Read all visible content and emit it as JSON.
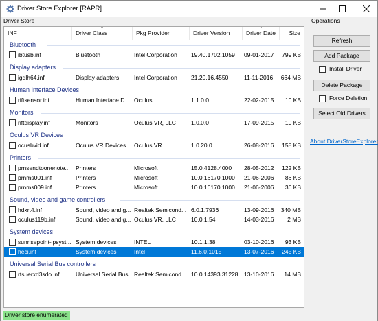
{
  "window": {
    "title": "Driver Store Explorer [RAPR]"
  },
  "labels": {
    "driver_store": "Driver Store",
    "operations": "Operations"
  },
  "columns": {
    "inf": "INF",
    "driver_class": "Driver Class",
    "pkg_provider": "Pkg Provider",
    "driver_version": "Driver Version",
    "driver_date": "Driver Date",
    "size": "Size"
  },
  "groups": {
    "bluetooth": "Bluetooth",
    "display_adapters": "Display adapters",
    "human_interface_devices": "Human Interface Devices",
    "monitors": "Monitors",
    "oculus_vr_devices": "Oculus VR Devices",
    "printers": "Printers",
    "sound_video_game": "Sound, video and game controllers",
    "system_devices": "System devices",
    "usb_controllers": "Universal Serial Bus controllers"
  },
  "rows": [
    {
      "inf": "ibtusb.inf",
      "class": "Bluetooth",
      "provider": "Intel Corporation",
      "version": "19.40.1702.1059",
      "date": "09-01-2017",
      "size": "799 KB"
    },
    {
      "inf": "igdlh64.inf",
      "class": "Display adapters",
      "provider": "Intel Corporation",
      "version": "21.20.16.4550",
      "date": "11-11-2016",
      "size": "664 MB"
    },
    {
      "inf": "riftsensor.inf",
      "class": "Human Interface D...",
      "provider": "Oculus",
      "version": "1.1.0.0",
      "date": "22-02-2015",
      "size": "10 KB"
    },
    {
      "inf": "riftdisplay.inf",
      "class": "Monitors",
      "provider": "Oculus VR, LLC",
      "version": "1.0.0.0",
      "date": "17-09-2015",
      "size": "10 KB"
    },
    {
      "inf": "ocusbvid.inf",
      "class": "Oculus VR Devices",
      "provider": "Oculus VR",
      "version": "1.0.20.0",
      "date": "26-08-2016",
      "size": "158 KB"
    },
    {
      "inf": "prnsendtoonenote...",
      "class": "Printers",
      "provider": "Microsoft",
      "version": "15.0.4128.4000",
      "date": "28-05-2012",
      "size": "122 KB"
    },
    {
      "inf": "prnms001.inf",
      "class": "Printers",
      "provider": "Microsoft",
      "version": "10.0.16170.1000",
      "date": "21-06-2006",
      "size": "86 KB"
    },
    {
      "inf": "prnms009.inf",
      "class": "Printers",
      "provider": "Microsoft",
      "version": "10.0.16170.1000",
      "date": "21-06-2006",
      "size": "36 KB"
    },
    {
      "inf": "hdxrt4.inf",
      "class": "Sound, video and g...",
      "provider": "Realtek Semicond...",
      "version": "6.0.1.7936",
      "date": "13-09-2016",
      "size": "340 MB"
    },
    {
      "inf": "oculus119b.inf",
      "class": "Sound, video and g...",
      "provider": "Oculus VR, LLC",
      "version": "10.0.1.54",
      "date": "14-03-2016",
      "size": "2 MB"
    },
    {
      "inf": "sunrisepoint-lpsyst...",
      "class": "System devices",
      "provider": "INTEL",
      "version": "10.1.1.38",
      "date": "03-10-2016",
      "size": "93 KB"
    },
    {
      "inf": "heci.inf",
      "class": "System devices",
      "provider": "Intel",
      "version": "11.6.0.1015",
      "date": "13-07-2016",
      "size": "245 KB"
    },
    {
      "inf": "rtsuerxd3sdo.inf",
      "class": "Universal Serial Bus...",
      "provider": "Realtek Semicond...",
      "version": "10.0.14393.31228",
      "date": "13-10-2016",
      "size": "14 MB"
    }
  ],
  "operations": {
    "refresh": "Refresh",
    "add_package": "Add Package",
    "install_driver": "Install Driver",
    "delete_package": "Delete Package",
    "force_deletion": "Force Deletion",
    "select_old_drivers": "Select Old Drivers",
    "about_link": "About DriverStoreExplorer"
  },
  "status": {
    "text": "Driver store enumerated",
    "color": "#8ae28a"
  },
  "colors": {
    "accent": "#0078d7",
    "group_header": "#1e3287",
    "link": "#0066cc"
  },
  "icons": {
    "app": "gear-icon",
    "minimize": "minimize-icon",
    "maximize": "maximize-icon",
    "close": "close-icon"
  }
}
